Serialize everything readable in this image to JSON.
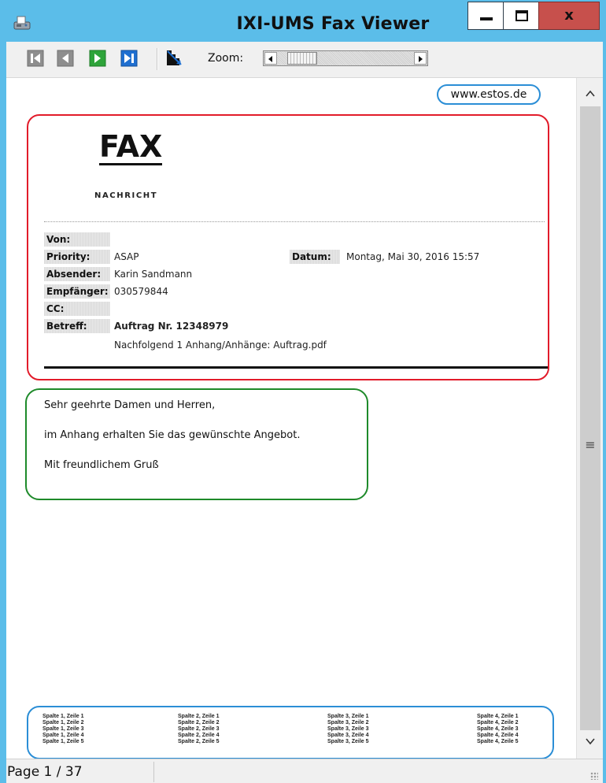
{
  "window": {
    "title": "IXI-UMS Fax Viewer",
    "controls": {
      "close_label": "x"
    },
    "colors": {
      "frame": "#5bbde9",
      "close": "#c7504c"
    }
  },
  "toolbar": {
    "buttons": [
      "first-page-icon",
      "previous-page-icon",
      "next-page-icon",
      "last-page-icon",
      "fit-page-icon"
    ],
    "zoom_label": "Zoom:"
  },
  "document": {
    "url": "www.estos.de",
    "header": {
      "title": "FAX",
      "subtitle": "NACHRICHT",
      "fields": [
        {
          "label": "Von:",
          "value": ""
        },
        {
          "label": "Priority:",
          "value": "ASAP"
        },
        {
          "label": "Absender:",
          "value": "Karin Sandmann"
        },
        {
          "label": "Empfänger:",
          "value": "030579844"
        },
        {
          "label": "CC:",
          "value": ""
        },
        {
          "label": "Betreff:",
          "value": "Auftrag Nr. 12348979"
        },
        {
          "label": "",
          "value": "Nachfolgend 1 Anhang/Anhänge: Auftrag.pdf"
        }
      ],
      "date_label": "Datum:",
      "date_value": "Montag, Mai 30, 2016 15:57"
    },
    "body": {
      "lines": [
        "Sehr geehrte Damen und Herren,",
        "im Anhang erhalten Sie das gewünschte Angebot.",
        "Mit freundlichem Gruß"
      ]
    },
    "footer": {
      "columns": [
        [
          "Spalte 1, Zeile 1",
          "Spalte 1, Zeile 2",
          "Spalte 1, Zeile 3",
          "Spalte 1, Zeile 4",
          "Spalte 1, Zeile 5"
        ],
        [
          "Spalte 2, Zeile 1",
          "Spalte 2, Zeile 2",
          "Spalte 2, Zeile 3",
          "Spalte 2, Zeile 4",
          "Spalte 2, Zeile 5"
        ],
        [
          "Spalte 3, Zeile 1",
          "Spalte 3, Zeile 2",
          "Spalte 3, Zeile 3",
          "Spalte 3, Zeile 4",
          "Spalte 3, Zeile 5"
        ],
        [
          "Spalte 4, Zeile 1",
          "Spalte 4, Zeile 2",
          "Spalte 4, Zeile 3",
          "Spalte 4, Zeile 4",
          "Spalte 4, Zeile 5"
        ]
      ]
    },
    "annotation_colors": {
      "url": "#2b8ed6",
      "header": "#e21b2a",
      "body": "#1e8a2a",
      "footer": "#2b8ed6"
    }
  },
  "status": {
    "page_label": "Page 1 / 37"
  }
}
